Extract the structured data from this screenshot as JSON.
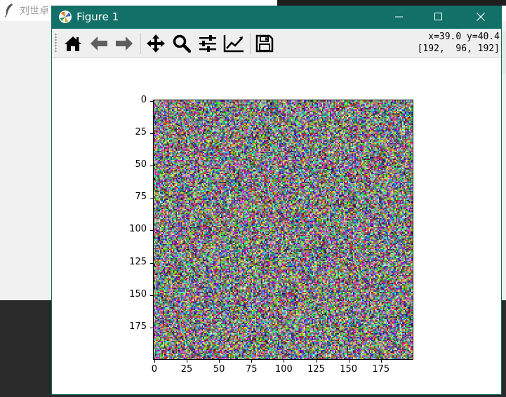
{
  "background_app": {
    "title": "刘世卓"
  },
  "window": {
    "title": "Figure 1",
    "title_bar_color": "#137068"
  },
  "toolbar": {
    "buttons": [
      {
        "name": "home",
        "icon": "home-icon"
      },
      {
        "name": "back",
        "icon": "arrow-left-icon"
      },
      {
        "name": "forward",
        "icon": "arrow-right-icon"
      },
      {
        "name": "pan",
        "icon": "move-icon"
      },
      {
        "name": "zoom",
        "icon": "magnifier-icon"
      },
      {
        "name": "configure-subplots",
        "icon": "sliders-icon"
      },
      {
        "name": "edit-axis",
        "icon": "line-chart-icon"
      },
      {
        "name": "save",
        "icon": "floppy-disk-icon"
      }
    ],
    "coords_line1": "x=39.0 y=40.4",
    "coords_line2": "[192,  96, 192]"
  },
  "chart_data": {
    "type": "heatmap",
    "description_values": "random RGB noise image, 200x200 pixels",
    "x_ticks": [
      "0",
      "25",
      "50",
      "75",
      "100",
      "125",
      "150",
      "175"
    ],
    "y_ticks": [
      "0",
      "25",
      "50",
      "75",
      "100",
      "125",
      "150",
      "175"
    ],
    "xlim": [
      0,
      200
    ],
    "ylim": [
      200,
      0
    ],
    "image_size": [
      200,
      200
    ]
  }
}
